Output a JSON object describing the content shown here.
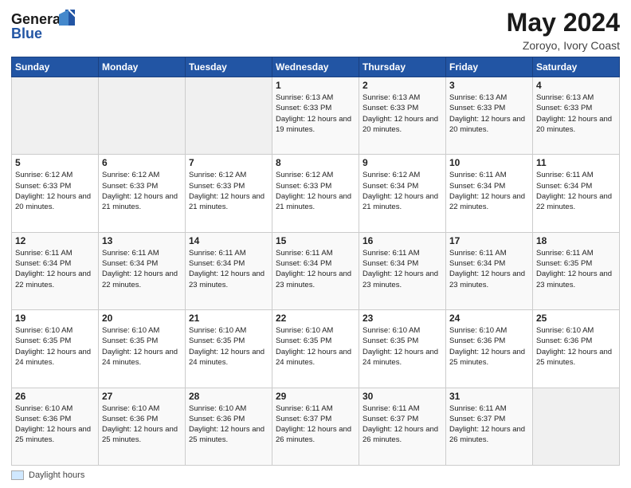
{
  "header": {
    "logo_line1": "General",
    "logo_line2": "Blue",
    "title": "May 2024",
    "subtitle": "Zoroyo, Ivory Coast"
  },
  "weekdays": [
    "Sunday",
    "Monday",
    "Tuesday",
    "Wednesday",
    "Thursday",
    "Friday",
    "Saturday"
  ],
  "weeks": [
    [
      {
        "day": "",
        "info": ""
      },
      {
        "day": "",
        "info": ""
      },
      {
        "day": "",
        "info": ""
      },
      {
        "day": "1",
        "info": "Sunrise: 6:13 AM\nSunset: 6:33 PM\nDaylight: 12 hours\nand 19 minutes."
      },
      {
        "day": "2",
        "info": "Sunrise: 6:13 AM\nSunset: 6:33 PM\nDaylight: 12 hours\nand 20 minutes."
      },
      {
        "day": "3",
        "info": "Sunrise: 6:13 AM\nSunset: 6:33 PM\nDaylight: 12 hours\nand 20 minutes."
      },
      {
        "day": "4",
        "info": "Sunrise: 6:13 AM\nSunset: 6:33 PM\nDaylight: 12 hours\nand 20 minutes."
      }
    ],
    [
      {
        "day": "5",
        "info": "Sunrise: 6:12 AM\nSunset: 6:33 PM\nDaylight: 12 hours\nand 20 minutes."
      },
      {
        "day": "6",
        "info": "Sunrise: 6:12 AM\nSunset: 6:33 PM\nDaylight: 12 hours\nand 21 minutes."
      },
      {
        "day": "7",
        "info": "Sunrise: 6:12 AM\nSunset: 6:33 PM\nDaylight: 12 hours\nand 21 minutes."
      },
      {
        "day": "8",
        "info": "Sunrise: 6:12 AM\nSunset: 6:33 PM\nDaylight: 12 hours\nand 21 minutes."
      },
      {
        "day": "9",
        "info": "Sunrise: 6:12 AM\nSunset: 6:34 PM\nDaylight: 12 hours\nand 21 minutes."
      },
      {
        "day": "10",
        "info": "Sunrise: 6:11 AM\nSunset: 6:34 PM\nDaylight: 12 hours\nand 22 minutes."
      },
      {
        "day": "11",
        "info": "Sunrise: 6:11 AM\nSunset: 6:34 PM\nDaylight: 12 hours\nand 22 minutes."
      }
    ],
    [
      {
        "day": "12",
        "info": "Sunrise: 6:11 AM\nSunset: 6:34 PM\nDaylight: 12 hours\nand 22 minutes."
      },
      {
        "day": "13",
        "info": "Sunrise: 6:11 AM\nSunset: 6:34 PM\nDaylight: 12 hours\nand 22 minutes."
      },
      {
        "day": "14",
        "info": "Sunrise: 6:11 AM\nSunset: 6:34 PM\nDaylight: 12 hours\nand 23 minutes."
      },
      {
        "day": "15",
        "info": "Sunrise: 6:11 AM\nSunset: 6:34 PM\nDaylight: 12 hours\nand 23 minutes."
      },
      {
        "day": "16",
        "info": "Sunrise: 6:11 AM\nSunset: 6:34 PM\nDaylight: 12 hours\nand 23 minutes."
      },
      {
        "day": "17",
        "info": "Sunrise: 6:11 AM\nSunset: 6:34 PM\nDaylight: 12 hours\nand 23 minutes."
      },
      {
        "day": "18",
        "info": "Sunrise: 6:11 AM\nSunset: 6:35 PM\nDaylight: 12 hours\nand 23 minutes."
      }
    ],
    [
      {
        "day": "19",
        "info": "Sunrise: 6:10 AM\nSunset: 6:35 PM\nDaylight: 12 hours\nand 24 minutes."
      },
      {
        "day": "20",
        "info": "Sunrise: 6:10 AM\nSunset: 6:35 PM\nDaylight: 12 hours\nand 24 minutes."
      },
      {
        "day": "21",
        "info": "Sunrise: 6:10 AM\nSunset: 6:35 PM\nDaylight: 12 hours\nand 24 minutes."
      },
      {
        "day": "22",
        "info": "Sunrise: 6:10 AM\nSunset: 6:35 PM\nDaylight: 12 hours\nand 24 minutes."
      },
      {
        "day": "23",
        "info": "Sunrise: 6:10 AM\nSunset: 6:35 PM\nDaylight: 12 hours\nand 24 minutes."
      },
      {
        "day": "24",
        "info": "Sunrise: 6:10 AM\nSunset: 6:36 PM\nDaylight: 12 hours\nand 25 minutes."
      },
      {
        "day": "25",
        "info": "Sunrise: 6:10 AM\nSunset: 6:36 PM\nDaylight: 12 hours\nand 25 minutes."
      }
    ],
    [
      {
        "day": "26",
        "info": "Sunrise: 6:10 AM\nSunset: 6:36 PM\nDaylight: 12 hours\nand 25 minutes."
      },
      {
        "day": "27",
        "info": "Sunrise: 6:10 AM\nSunset: 6:36 PM\nDaylight: 12 hours\nand 25 minutes."
      },
      {
        "day": "28",
        "info": "Sunrise: 6:10 AM\nSunset: 6:36 PM\nDaylight: 12 hours\nand 25 minutes."
      },
      {
        "day": "29",
        "info": "Sunrise: 6:11 AM\nSunset: 6:37 PM\nDaylight: 12 hours\nand 26 minutes."
      },
      {
        "day": "30",
        "info": "Sunrise: 6:11 AM\nSunset: 6:37 PM\nDaylight: 12 hours\nand 26 minutes."
      },
      {
        "day": "31",
        "info": "Sunrise: 6:11 AM\nSunset: 6:37 PM\nDaylight: 12 hours\nand 26 minutes."
      },
      {
        "day": "",
        "info": ""
      }
    ]
  ],
  "footer": {
    "label": "Daylight hours"
  }
}
